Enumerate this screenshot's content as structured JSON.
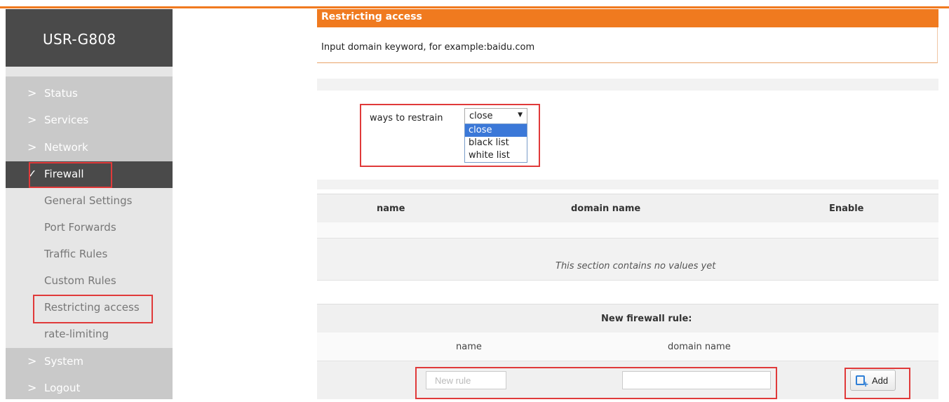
{
  "app": {
    "title": "USR-G808"
  },
  "sidebar": {
    "items": [
      {
        "label": "Status",
        "chevron": ">"
      },
      {
        "label": "Services",
        "chevron": ">"
      },
      {
        "label": "Network",
        "chevron": ">"
      },
      {
        "label": "Firewall",
        "chevron": "✓",
        "active": true
      },
      {
        "label": "System",
        "chevron": ">"
      },
      {
        "label": "Logout",
        "chevron": ">"
      }
    ],
    "firewall_subitems": [
      {
        "label": "General Settings"
      },
      {
        "label": "Port Forwards"
      },
      {
        "label": "Traffic Rules"
      },
      {
        "label": "Custom Rules"
      },
      {
        "label": "Restricting access",
        "highlighted": true
      },
      {
        "label": "rate-limiting"
      }
    ]
  },
  "page": {
    "title": "Restricting access",
    "description": "Input domain keyword, for example:baidu.com"
  },
  "restrain": {
    "label": "ways to restrain",
    "selected": "close",
    "options": [
      "close",
      "black list",
      "white list"
    ]
  },
  "table": {
    "columns": [
      "name",
      "domain name",
      "Enable"
    ],
    "empty_message": "This section contains no values yet"
  },
  "new_rule": {
    "title": "New firewall rule:",
    "col_name": "name",
    "col_domain": "domain name",
    "name_placeholder": "New rule",
    "domain_value": "",
    "add_label": "Add"
  },
  "colors": {
    "accent": "#f07a1f",
    "sidebar_dark": "#4a4a4a",
    "highlight_box": "#e03a3a"
  }
}
